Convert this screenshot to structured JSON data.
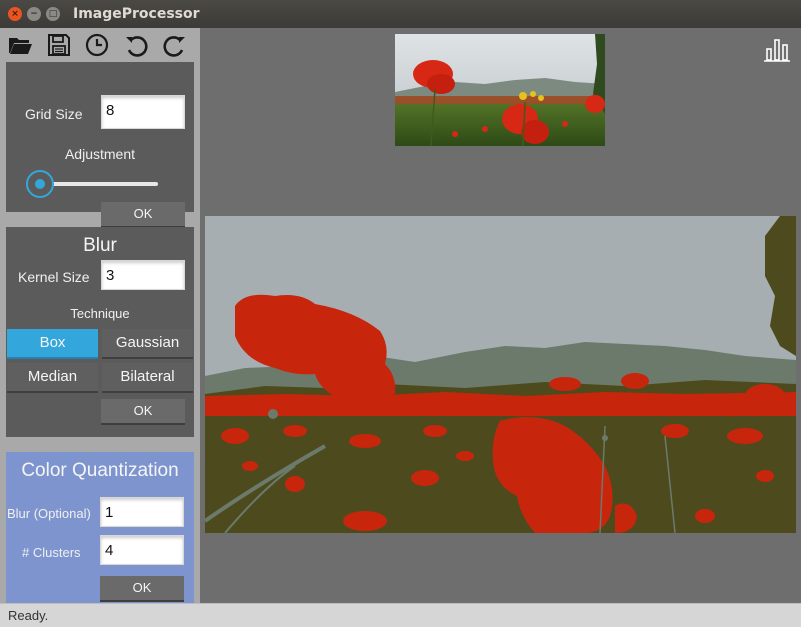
{
  "window": {
    "title": "ImageProcessor",
    "controls": {
      "close": "×",
      "minimize": "−",
      "maximize": "□"
    }
  },
  "toolbar": {
    "icons": [
      "open-folder-icon",
      "save-icon",
      "history-clock-icon",
      "undo-icon",
      "redo-icon"
    ]
  },
  "grid_panel": {
    "grid_size_label": "Grid Size",
    "grid_size_value": "8",
    "adjustment_label": "Adjustment",
    "adjustment_level": 0.0,
    "ok_label": "OK"
  },
  "blur_panel": {
    "title": "Blur",
    "kernel_size_label": "Kernel Size",
    "kernel_size_value": "3",
    "technique_label": "Technique",
    "techniques": [
      "Box",
      "Gaussian",
      "Median",
      "Bilateral"
    ],
    "selected_technique": "Box",
    "ok_label": "OK"
  },
  "quant_panel": {
    "title": "Color Quantization",
    "blur_label": "Blur (Optional)",
    "blur_value": "1",
    "clusters_label": "# Clusters",
    "clusters_value": "4",
    "ok_label": "OK"
  },
  "canvas": {
    "histogram_icon": "histogram-icon"
  },
  "status": {
    "text": "Ready."
  },
  "colors": {
    "accent": "#33a6dc",
    "quant_panel_bg": "#7d94cf",
    "quant_red": "#c8250d",
    "quant_olive": "#4d4b1d",
    "quant_sky": "#a6aeb2",
    "quant_hill": "#6c7a6b"
  }
}
